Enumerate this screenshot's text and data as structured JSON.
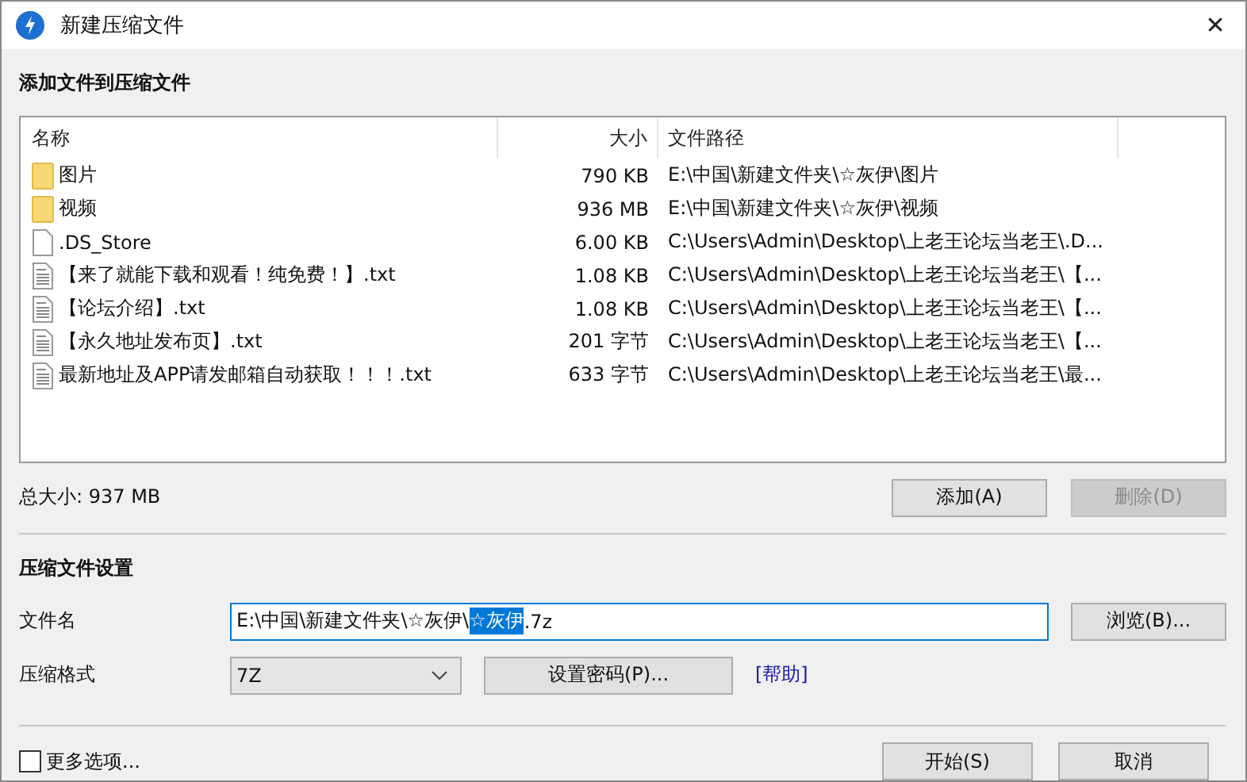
{
  "window": {
    "title": "新建压缩文件",
    "close": "✕"
  },
  "files_section": {
    "title": "添加文件到压缩文件"
  },
  "table": {
    "columns": [
      "名称",
      "大小",
      "文件路径"
    ],
    "rows": [
      {
        "kind": "folder",
        "name": "图片",
        "size": "790 KB",
        "path": "E:\\中国\\新建文件夹\\☆灰伊\\图片"
      },
      {
        "kind": "folder",
        "name": "视频",
        "size": "936 MB",
        "path": "E:\\中国\\新建文件夹\\☆灰伊\\视频"
      },
      {
        "kind": "file",
        "name": ".DS_Store",
        "size": "6.00 KB",
        "path": "C:\\Users\\Admin\\Desktop\\上老王论坛当老王\\.D..."
      },
      {
        "kind": "text",
        "name": "【来了就能下载和观看！纯免费！】.txt",
        "size": "1.08 KB",
        "path": "C:\\Users\\Admin\\Desktop\\上老王论坛当老王\\【..."
      },
      {
        "kind": "text",
        "name": "【论坛介绍】.txt",
        "size": "1.08 KB",
        "path": "C:\\Users\\Admin\\Desktop\\上老王论坛当老王\\【..."
      },
      {
        "kind": "text",
        "name": "【永久地址发布页】.txt",
        "size": "201 字节",
        "path": "C:\\Users\\Admin\\Desktop\\上老王论坛当老王\\【..."
      },
      {
        "kind": "text",
        "name": "最新地址及APP请发邮箱自动获取！！！.txt",
        "size": "633 字节",
        "path": "C:\\Users\\Admin\\Desktop\\上老王论坛当老王\\最..."
      }
    ]
  },
  "total_size": "总大小: 937 MB",
  "list_buttons": [
    {
      "label": "添加(A)",
      "disabled": false
    },
    {
      "label": "删除(D)",
      "disabled": true
    }
  ],
  "settings_section": {
    "title": "压缩文件设置"
  },
  "file_name": {
    "label": "文件名",
    "value_parts": [
      {
        "text": "E:\\中国\\新建文件夹\\☆灰伊\\",
        "selected": false
      },
      {
        "text": "☆灰伊",
        "selected": true
      },
      {
        "text": ".7z",
        "selected": false
      }
    ],
    "browse_button": "浏览(B)..."
  },
  "format": {
    "label": "压缩格式",
    "value": "7Z",
    "password_button": "设置密码(P)...",
    "help_link": "[帮助]"
  },
  "more_options": {
    "label": "更多选项...",
    "checked": false
  },
  "footer_buttons": [
    "开始(S)",
    "取消"
  ]
}
